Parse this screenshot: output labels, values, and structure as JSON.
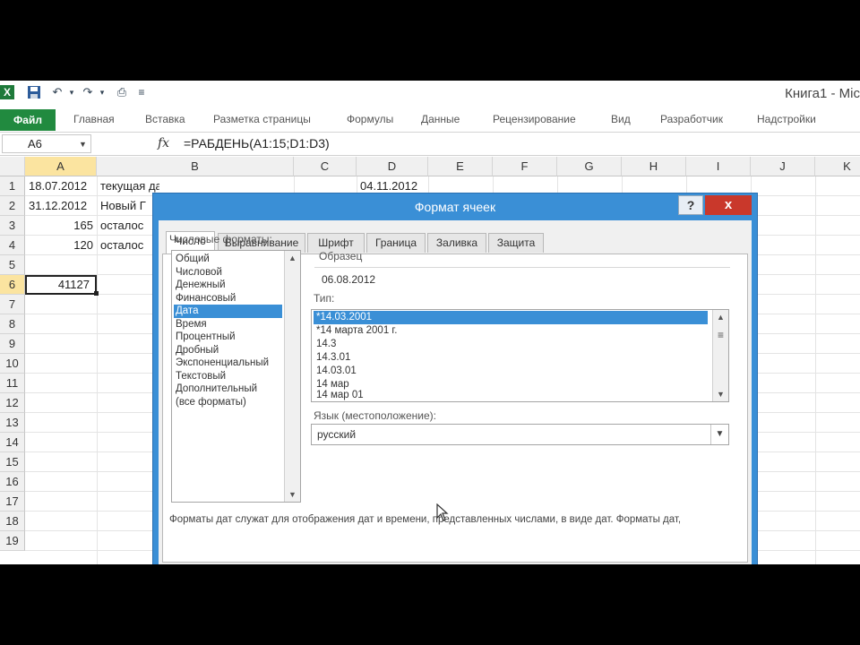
{
  "titlebar": {
    "window_title": "Книга1 - Mic",
    "qat": [
      "excel-logo",
      "save-icon",
      "undo-icon",
      "redo-icon",
      "print-preview-icon"
    ]
  },
  "ribbon": {
    "file_tab": "Файл",
    "tabs": [
      "Главная",
      "Вставка",
      "Разметка страницы",
      "Формулы",
      "Данные",
      "Рецензирование",
      "Вид",
      "Разработчик",
      "Надстройки"
    ]
  },
  "formula_bar": {
    "name_box": "A6",
    "fx": "fx",
    "formula": "=РАБДЕНЬ(A1:15;D1:D3)"
  },
  "grid": {
    "columns": [
      "A",
      "B",
      "C",
      "D",
      "E",
      "F",
      "G",
      "H",
      "I",
      "J",
      "K"
    ],
    "selected_column": "A",
    "rows": [
      "1",
      "2",
      "3",
      "4",
      "5",
      "6",
      "7",
      "8",
      "9",
      "10",
      "11",
      "12",
      "13",
      "14",
      "15",
      "16",
      "17",
      "18",
      "19"
    ],
    "selected_row": "6",
    "cells": {
      "A1": "18.07.2012",
      "B1": "текущая дата",
      "D1": "04.11.2012",
      "A2": "31.12.2012",
      "B2": "Новый Г",
      "A3": "165",
      "B3": "осталос",
      "A4": "120",
      "B4": "осталос",
      "A6": "41127"
    }
  },
  "dialog": {
    "title": "Формат ячеек",
    "help": "?",
    "close": "x",
    "tabs": [
      "Число",
      "Выравнивание",
      "Шрифт",
      "Граница",
      "Заливка",
      "Защита"
    ],
    "active_tab": "Число",
    "categories_label": "Числовые форматы:",
    "categories": [
      "Общий",
      "Числовой",
      "Денежный",
      "Финансовый",
      "Дата",
      "Время",
      "Процентный",
      "Дробный",
      "Экспоненциальный",
      "Текстовый",
      "Дополнительный",
      "(все форматы)"
    ],
    "selected_category": "Дата",
    "sample_label": "Образец",
    "sample_value": "06.08.2012",
    "type_label": "Тип:",
    "types": [
      "*14.03.2001",
      "*14 марта 2001 г.",
      "14.3",
      "14.3.01",
      "14.03.01",
      "14 мар",
      "14 мар 01"
    ],
    "selected_type": "*14.03.2001",
    "locale_label": "Язык (местоположение):",
    "locale_value": "русский",
    "description": "Форматы дат служат для отображения дат и времени, представленных числами, в виде дат. Форматы дат,"
  }
}
